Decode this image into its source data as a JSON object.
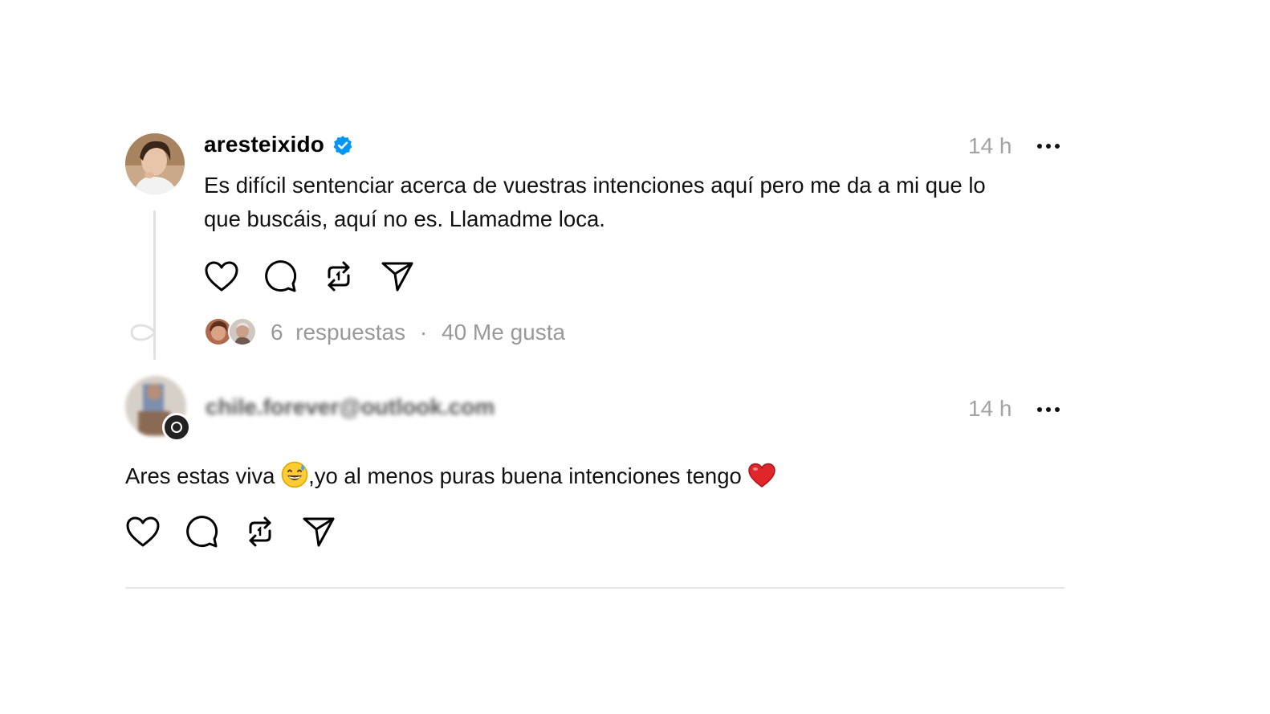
{
  "post": {
    "username": "aresteixido",
    "verified_icon": "verified-badge-icon",
    "time": "14 h",
    "text_line1": "Es difícil sentenciar acerca de vuestras intenciones aquí pero me da a mi que lo",
    "text_line2": "que buscáis, aquí no es. Llamadme loca.",
    "replies": "6  respuestas",
    "separator": "·",
    "likes": "40 Me gusta",
    "actions": [
      "heart-icon",
      "comment-icon",
      "repost-icon",
      "share-icon"
    ]
  },
  "reply": {
    "username": "chile.forever@outlook.com",
    "time": "14 h",
    "text_before_emoji": "Ares estas viva ",
    "text_after_emoji": ",yo al menos puras buena intenciones tengo ",
    "emoji1": "sweat-smile-emoji",
    "emoji2": "red-heart-emoji",
    "actions": [
      "heart-icon",
      "comment-icon",
      "repost-icon",
      "share-icon"
    ]
  },
  "colors": {
    "verified_blue": "#0095f6",
    "muted_text": "#999999",
    "divider": "#e6e6e6",
    "heart_red": "#e0262b"
  }
}
